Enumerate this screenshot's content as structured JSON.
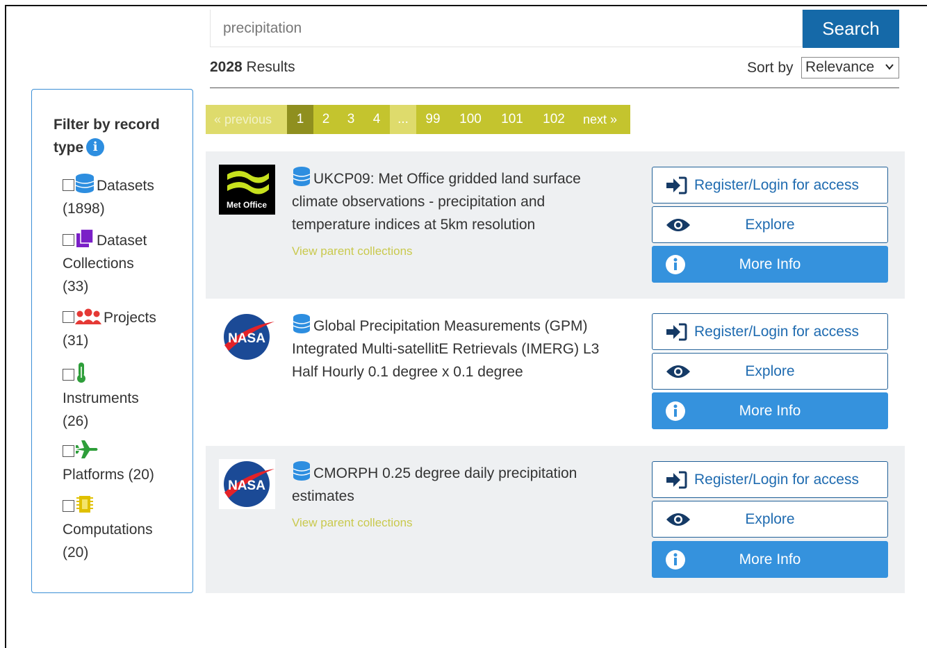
{
  "search": {
    "value": "precipitation",
    "button_label": "Search"
  },
  "results": {
    "count": "2028",
    "count_suffix": " Results",
    "sort_label": "Sort by",
    "sort_value": "Relevance"
  },
  "filter": {
    "title": "Filter by record type",
    "items": [
      {
        "label": "Datasets",
        "count": "(1898)",
        "icon": "database-icon",
        "color": "#2d8ee0"
      },
      {
        "label": "Dataset",
        "label2": "Collections",
        "count": "(33)",
        "icon": "collection-icon",
        "color": "#7a1fc7"
      },
      {
        "label": "Projects",
        "count": "(31)",
        "icon": "users-icon",
        "color": "#e53935"
      },
      {
        "label": "Instruments",
        "count": "(26)",
        "icon": "thermometer-icon",
        "color": "#2e9e3a"
      },
      {
        "label": "Platforms (20)",
        "count": "",
        "icon": "plane-icon",
        "color": "#2e9e3a"
      },
      {
        "label": "Computations",
        "count": "(20)",
        "icon": "chip-icon",
        "color": "#e0c000"
      }
    ]
  },
  "pagination": {
    "prev": "« previous",
    "pages": [
      "1",
      "2",
      "3",
      "4",
      "...",
      "99",
      "100",
      "101",
      "102"
    ],
    "next": "next »",
    "active": "1"
  },
  "cards": [
    {
      "logo": "Met Office",
      "title": "UKCP09: Met Office gridded land surface climate observations - precipitation and temperature indices at 5km resolution",
      "parent_link": "View parent collections",
      "register": "Register/Login for access",
      "explore": "Explore",
      "more_info": "More Info"
    },
    {
      "logo": "NASA",
      "title": "Global Precipitation Measurements (GPM) Integrated Multi-satellitE Retrievals (IMERG) L3 Half Hourly 0.1 degree x 0.1 degree",
      "parent_link": "",
      "register": "Register/Login for access",
      "explore": "Explore",
      "more_info": "More Info"
    },
    {
      "logo": "NASA",
      "title": "CMORPH 0.25 degree daily precipitation estimates",
      "parent_link": "View parent collections",
      "register": "Register/Login for access",
      "explore": "Explore",
      "more_info": "More Info"
    }
  ],
  "colors": {
    "search_button": "#1569a8",
    "pagination": "#c4c42e",
    "pagination_active": "#8f8f1f",
    "primary_button": "#3592dd",
    "link": "#c9c94d"
  }
}
